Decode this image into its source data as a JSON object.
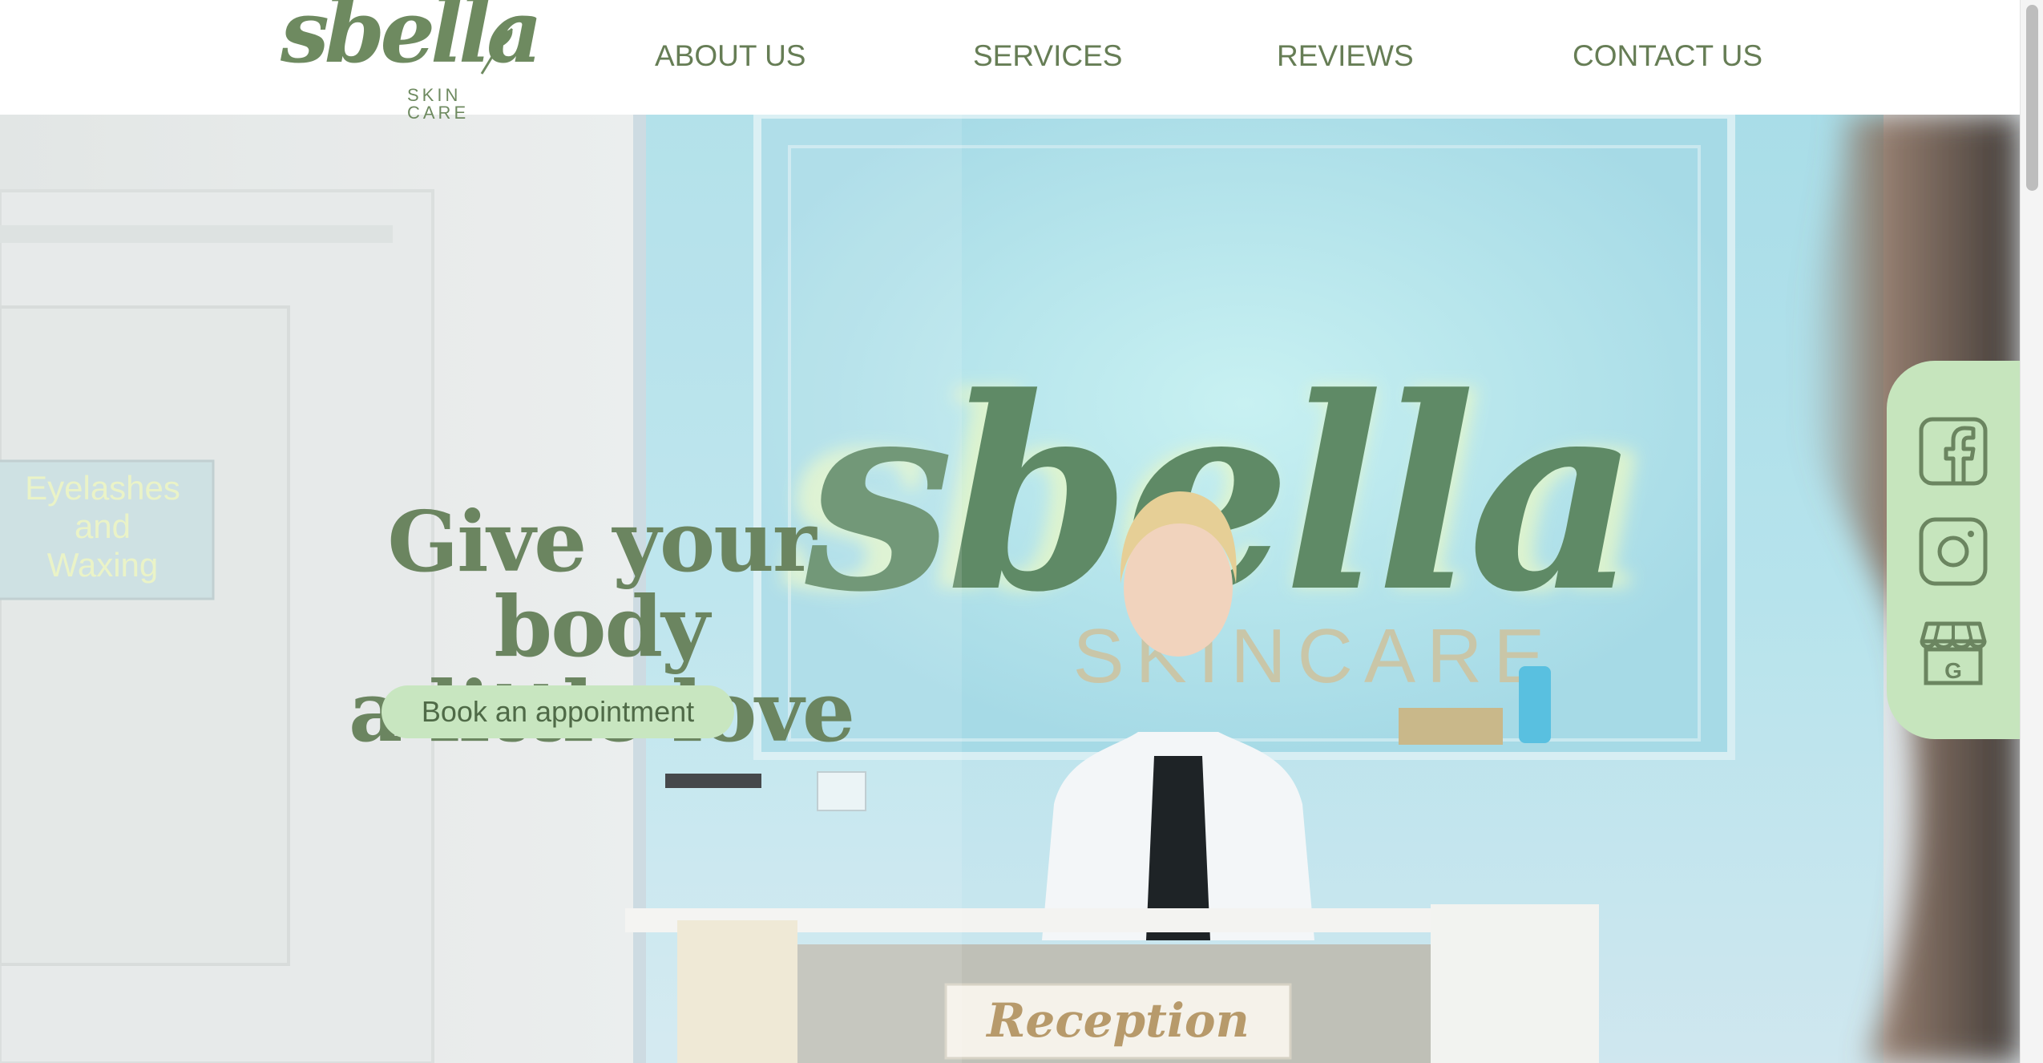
{
  "brand": {
    "wordmark": "sbella",
    "tagline": "SKIN CARE",
    "colors": {
      "primary_green": "#6b8560",
      "nav_green": "#667d55",
      "accent_mint": "#c8e6c0",
      "rail_mint": "#c6e5bd"
    }
  },
  "nav": {
    "items": [
      {
        "label": "ABOUT US"
      },
      {
        "label": "SERVICES"
      },
      {
        "label": "REVIEWS"
      },
      {
        "label": "CONTACT US"
      }
    ]
  },
  "hero": {
    "headline_line1": "Give your body",
    "headline_line2": "a little love",
    "cta_label": "Book an appointment",
    "scene": {
      "wall_sign": "sbella",
      "wall_sign_sub": "SKINCARE",
      "door_sign_line1": "Eyelashes",
      "door_sign_line2": "and",
      "door_sign_line3": "Waxing",
      "desk_plaque": "Reception"
    }
  },
  "social": {
    "icons": [
      "facebook-icon",
      "instagram-icon",
      "google-business-icon"
    ],
    "google_letter": "G"
  }
}
